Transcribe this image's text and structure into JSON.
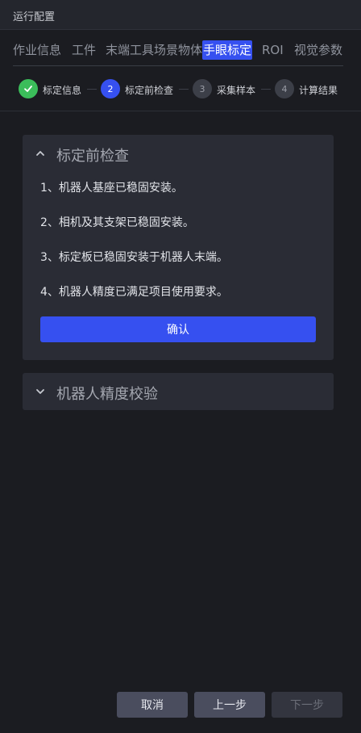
{
  "window": {
    "title": "运行配置"
  },
  "tabs": [
    {
      "label": "作业信息"
    },
    {
      "label": "工件"
    },
    {
      "label": "末端工具"
    },
    {
      "label": "场景物体"
    },
    {
      "label": "手眼标定"
    },
    {
      "label": "ROI"
    },
    {
      "label": "视觉参数"
    }
  ],
  "active_tab": "手眼标定",
  "steps": [
    {
      "number": "1",
      "label": "标定信息",
      "status": "done",
      "icon": "check-icon"
    },
    {
      "number": "2",
      "label": "标定前检查",
      "status": "current"
    },
    {
      "number": "3",
      "label": "采集样本",
      "status": "pending"
    },
    {
      "number": "4",
      "label": "计算结果",
      "status": "pending"
    }
  ],
  "precheck": {
    "title": "标定前检查",
    "expanded": true,
    "items": [
      "1、机器人基座已稳固安装。",
      "2、相机及其支架已稳固安装。",
      "3、标定板已稳固安装于机器人末端。",
      "4、机器人精度已满足项目使用要求。"
    ],
    "confirm_label": "确认"
  },
  "precision": {
    "title": "机器人精度校验",
    "expanded": false
  },
  "footer": {
    "cancel_label": "取消",
    "prev_label": "上一步",
    "next_label": "下一步"
  },
  "colors": {
    "accent": "#3650f0",
    "done": "#3bbd5a",
    "background": "#1b1c21",
    "card": "#2a2c35"
  }
}
